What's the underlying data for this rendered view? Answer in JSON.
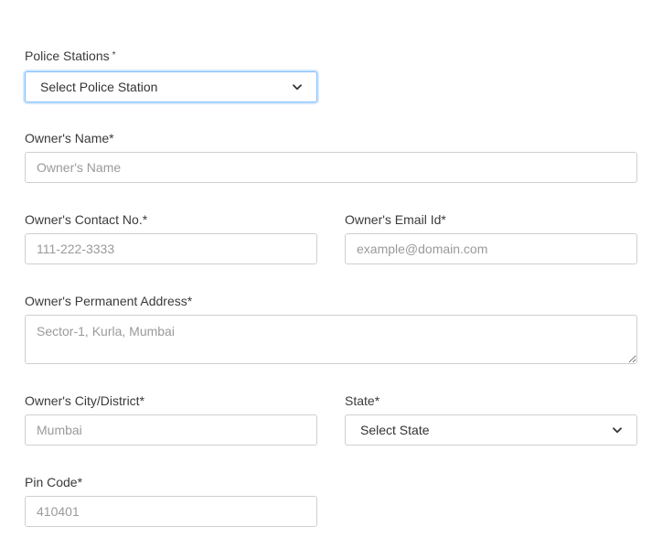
{
  "form": {
    "police_station": {
      "label": "Police Stations",
      "required_mark": "*",
      "selected": "Select Police Station"
    },
    "owner_name": {
      "label": "Owner's Name*",
      "placeholder": "Owner's Name"
    },
    "contact_no": {
      "label": "Owner's Contact No.*",
      "placeholder": "111-222-3333"
    },
    "email": {
      "label": "Owner's Email Id*",
      "placeholder": "example@domain.com"
    },
    "address": {
      "label": "Owner's Permanent Address*",
      "placeholder": "Sector-1, Kurla, Mumbai"
    },
    "city": {
      "label": "Owner's City/District*",
      "placeholder": "Mumbai"
    },
    "state": {
      "label": "State*",
      "selected": "Select State"
    },
    "pin_code": {
      "label": "Pin Code*",
      "placeholder": "410401"
    }
  },
  "icons": {
    "select_arrow": "chevron-down-icon"
  },
  "colors": {
    "focus_border": "#80bdff",
    "input_border": "#cfcfcf",
    "placeholder": "#9a9a9a"
  }
}
